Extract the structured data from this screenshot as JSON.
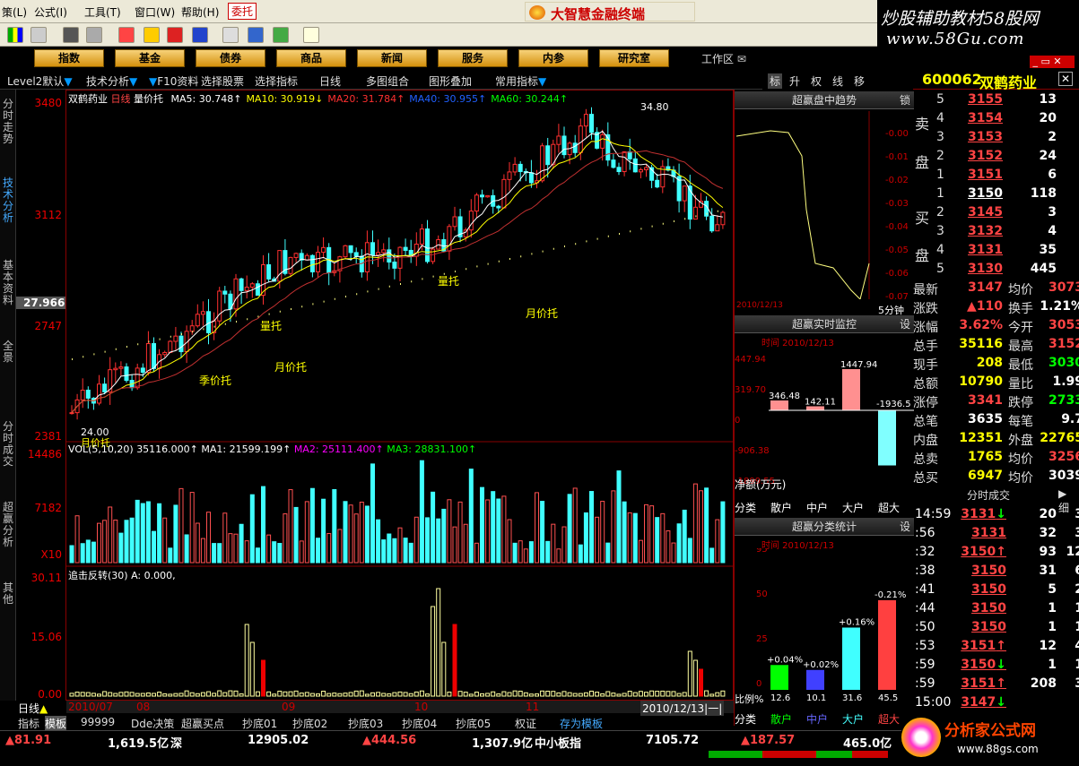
{
  "menu": [
    "策(L)",
    "公式(I)",
    "工具(T)",
    "窗口(W)",
    "帮助(H)",
    "委托"
  ],
  "app_title": "大智慧金融终端",
  "watermark": {
    "line1": "炒股辅助教材58股网",
    "line2": "www.58Gu.com"
  },
  "navbuttons": [
    "指数",
    "基金",
    "债券",
    "商品",
    "新闻",
    "服务",
    "内参",
    "研究室"
  ],
  "workarea": "工作区",
  "sectionbar": {
    "items": [
      "Level2默认",
      "技术分析",
      "F10资料",
      "选择股票",
      "选择指标",
      "日线",
      "多图组合",
      "图形叠加",
      "常用指标"
    ]
  },
  "right_tabs": [
    "标",
    "升",
    "权",
    "线",
    "移"
  ],
  "left_strip": [
    "分时走势",
    "技术分析",
    "基本资料",
    "全景",
    "分时成交",
    "超赢分析",
    "其他"
  ],
  "kline": {
    "stock": "双鹤药业",
    "period": "日线",
    "indicator": "量价托",
    "ma": [
      {
        "name": "MA5",
        "value": "30.748",
        "arrow": "↑",
        "color": "#ffffff"
      },
      {
        "name": "MA10",
        "value": "30.919",
        "arrow": "↓",
        "color": "#ffff00"
      },
      {
        "name": "MA20",
        "value": "31.784",
        "arrow": "↑",
        "color": "#ff3030"
      },
      {
        "name": "MA40",
        "value": "30.955",
        "arrow": "↑",
        "color": "#2060ff"
      },
      {
        "name": "MA60",
        "value": "30.244",
        "arrow": "↑",
        "color": "#00ff00"
      }
    ],
    "yticks": [
      "3480",
      "3112",
      "27.966",
      "2747",
      "2381"
    ],
    "high": "34.80",
    "low": "24.00",
    "annotations": [
      "季价托",
      "量托",
      "月价托",
      "量托",
      "月价托"
    ],
    "low_label": "月价托"
  },
  "vol": {
    "header": "VOL(5,10,20)",
    "vol_val": "35116.000↑",
    "ma1": "MA1: 21599.199↑",
    "ma2": "MA2: 25111.400↑",
    "ma3": "MA3: 28831.100↑",
    "yticks": [
      "14486",
      "7182",
      "X10"
    ]
  },
  "ind": {
    "header": "追击反转(30)",
    "a": "A: 0.000,",
    "yticks": [
      "30.11",
      "15.06",
      "0.00"
    ]
  },
  "xaxis": [
    "2010/07",
    "08",
    "09",
    "10",
    "11"
  ],
  "xdate": "2010/12/13|一|",
  "trend": {
    "title": "超赢盘中趋势",
    "btn": "锁",
    "pct": [
      "-0.00",
      "-0.01",
      "-0.02",
      "-0.03",
      "-0.04",
      "-0.05",
      "-0.06",
      "-0.07"
    ],
    "date": "2010/12/13",
    "footer": "5分钟",
    "footer_btn": "设"
  },
  "monitor": {
    "title": "超赢实时监控",
    "btn": "设",
    "date": "时间 2010/12/13",
    "yticks": [
      "447.94",
      "319.70",
      "0",
      "-906.38",
      "-1899.55"
    ],
    "values": [
      {
        "label": "346.48",
        "v": 346.48
      },
      {
        "label": "142.11",
        "v": 142.11
      },
      {
        "label": "1447.94",
        "v": 1447.94
      },
      {
        "label": "-1936.5",
        "v": -1936.5
      }
    ],
    "unit": "净额(万元)",
    "xlbl": [
      "分类",
      "散户",
      "中户",
      "大户",
      "超大"
    ]
  },
  "classstat": {
    "title": "超赢分类统计",
    "btn": "设",
    "date": "时间 2010/12/13",
    "yticks": [
      "95",
      "50",
      "25",
      "0"
    ],
    "bars": [
      {
        "pct": "+0.04%",
        "ratio": "12.6",
        "v": 12.6,
        "color": "#00ff00"
      },
      {
        "pct": "+0.02%",
        "ratio": "10.1",
        "v": 10.1,
        "color": "#4040ff"
      },
      {
        "pct": "+0.16%",
        "ratio": "31.6",
        "v": 31.6,
        "color": "#40ffff"
      },
      {
        "pct": "-0.21%",
        "ratio": "45.5",
        "v": 45.5,
        "color": "#ff4040"
      }
    ],
    "ratio_label": "比例%",
    "xlbl": [
      "分类",
      "散户",
      "中户",
      "大户",
      "超大"
    ]
  },
  "quote": {
    "code": "600062",
    "name": "双鹤药业",
    "asks": [
      {
        "n": "5",
        "p": "3155",
        "v": "13"
      },
      {
        "n": "4",
        "p": "3154",
        "v": "20"
      },
      {
        "n": "3",
        "p": "3153",
        "v": "2"
      },
      {
        "n": "2",
        "p": "3152",
        "v": "24"
      },
      {
        "n": "1",
        "p": "3151",
        "v": "6"
      }
    ],
    "bids": [
      {
        "n": "1",
        "p": "3150",
        "v": "118"
      },
      {
        "n": "2",
        "p": "3145",
        "v": "3"
      },
      {
        "n": "3",
        "p": "3132",
        "v": "4"
      },
      {
        "n": "4",
        "p": "3131",
        "v": "35"
      },
      {
        "n": "5",
        "p": "3130",
        "v": "445"
      }
    ],
    "ask_label": [
      "卖",
      "盘"
    ],
    "bid_label": [
      "买",
      "盘"
    ],
    "stats": [
      [
        "最新",
        "3147",
        "均价",
        "3073"
      ],
      [
        "涨跌",
        "▲110",
        "换手",
        "1.21%"
      ],
      [
        "涨幅",
        "3.62%",
        "今开",
        "3053"
      ],
      [
        "总手",
        "35116",
        "最高",
        "3152"
      ],
      [
        "现手",
        "208",
        "最低",
        "3030"
      ],
      [
        "总额",
        "10790",
        "量比",
        "1.99"
      ],
      [
        "涨停",
        "3341",
        "跌停",
        "2733"
      ],
      [
        "总笔",
        "3635",
        "每笔",
        "9.7"
      ],
      [
        "内盘",
        "12351",
        "外盘",
        "22765"
      ],
      [
        "总卖",
        "1765",
        "均价",
        "3256"
      ],
      [
        "总买",
        "6947",
        "均价",
        "3039"
      ]
    ],
    "tradetitle": "分时成交",
    "tradebtn": "细",
    "trades": [
      [
        "14:59",
        "3131↓",
        "20",
        "3"
      ],
      [
        ":56",
        "3131",
        "32",
        "3"
      ],
      [
        ":32",
        "3150↑",
        "93",
        "12"
      ],
      [
        ":38",
        "3150",
        "31",
        "6"
      ],
      [
        ":41",
        "3150",
        "5",
        "2"
      ],
      [
        ":44",
        "3150",
        "1",
        "1"
      ],
      [
        ":50",
        "3150",
        "1",
        "1"
      ],
      [
        ":53",
        "3151↑",
        "12",
        "4"
      ],
      [
        ":59",
        "3150↓",
        "1",
        "1"
      ],
      [
        ":59",
        "3151↑",
        "208",
        "3"
      ],
      [
        "15:00",
        "3147↓",
        "",
        ""
      ]
    ]
  },
  "bottomtabs": [
    "日线",
    "指标",
    "模板",
    "99999",
    "Dde决策",
    "超赢买点",
    "抄底01",
    "抄底02",
    "抄底03",
    "抄底04",
    "抄底05",
    "权证",
    "存为模板"
  ],
  "status": {
    "a": "▲81.91",
    "b": "1,619.5亿",
    "c": "深",
    "d": "12905.02",
    "e": "▲444.56",
    "f": "1,307.9亿",
    "g": "中小板指",
    "h": "7105.72",
    "i": "▲187.57",
    "j": "465.0亿"
  },
  "footlogo": {
    "t1": "分析家公式网",
    "t2": "www.88gs.com"
  }
}
